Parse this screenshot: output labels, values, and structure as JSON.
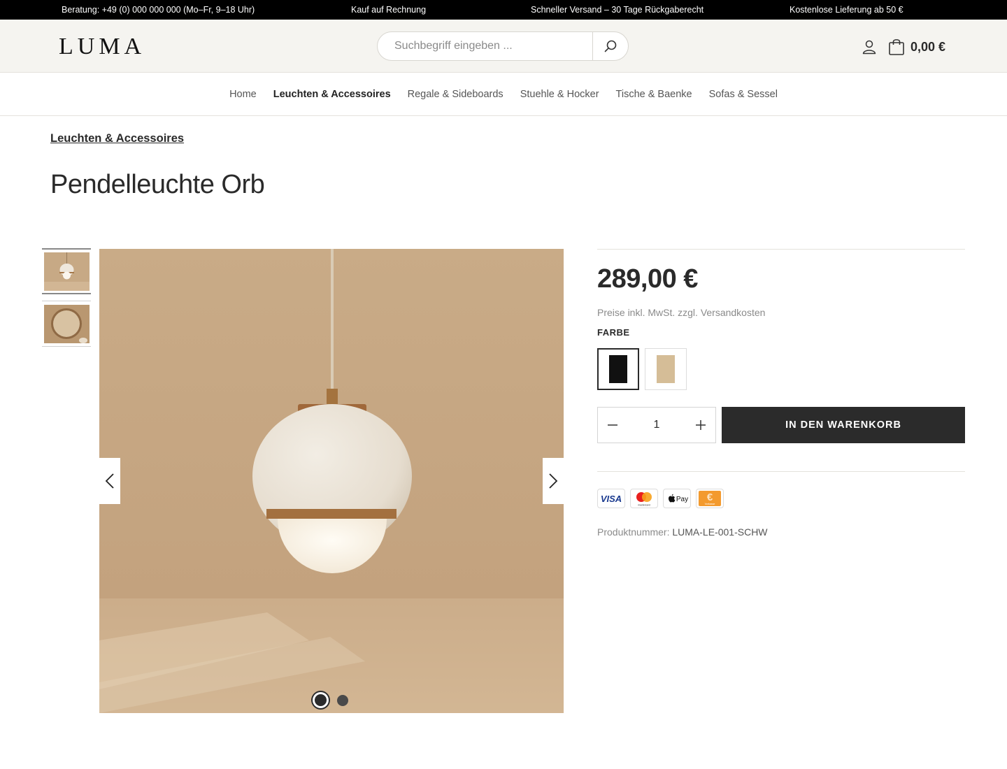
{
  "topbar": {
    "items": [
      "Beratung: +49 (0) 000 000 000 (Mo–Fr, 9–18 Uhr)",
      "Kauf auf Rechnung",
      "Schneller Versand – 30 Tage Rückgaberecht",
      "Kostenlose Lieferung ab 50 €"
    ]
  },
  "header": {
    "logo": "LUMA",
    "search_placeholder": "Suchbegriff eingeben ...",
    "search_icon": "search-icon",
    "account_icon": "user-icon",
    "cart_icon": "shopping-bag-icon",
    "cart_total": "0,00 €"
  },
  "nav": {
    "items": [
      {
        "label": "Home",
        "active": false
      },
      {
        "label": "Leuchten & Accessoires",
        "active": true
      },
      {
        "label": "Regale & Sideboards",
        "active": false
      },
      {
        "label": "Stuehle & Hocker",
        "active": false
      },
      {
        "label": "Tische & Baenke",
        "active": false
      },
      {
        "label": "Sofas & Sessel",
        "active": false
      }
    ]
  },
  "breadcrumb": "Leuchten & Accessoires",
  "product": {
    "title": "Pendelleuchte Orb",
    "price": "289,00 €",
    "tax_note": "Preise inkl. MwSt. zzgl. Versandkosten",
    "color_label": "FARBE",
    "colors": [
      {
        "name": "schwarz",
        "hex": "#111111",
        "selected": true
      },
      {
        "name": "sand",
        "hex": "#d5bd97",
        "selected": false
      }
    ],
    "quantity": "1",
    "add_to_cart": "IN DEN WARENKORB",
    "payment_methods": [
      "VISA",
      "mastercard",
      "Pay",
      "Vorkasse"
    ],
    "sku_label": "Produktnummer:",
    "sku_value": "LUMA-LE-001-SCHW"
  },
  "gallery": {
    "thumbnails": [
      "pendant-lamp-thumbnail",
      "round-mirror-thumbnail"
    ],
    "active_slide": 1,
    "slide_count": 2
  },
  "colors": {
    "topbar_bg": "#000000",
    "header_bg": "#f5f4f0",
    "button_bg": "#2b2b2b",
    "image_bg": "#c8ab89"
  }
}
